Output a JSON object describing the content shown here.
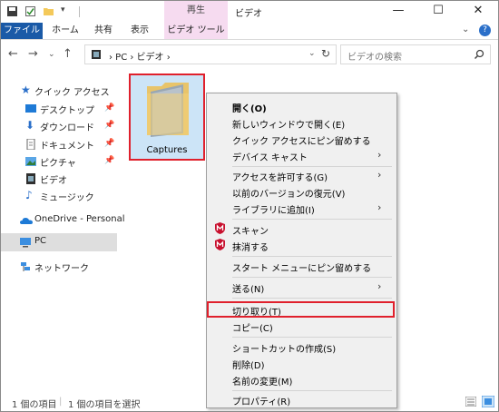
{
  "window": {
    "title": "ビデオ",
    "tools_group_label": "再生",
    "controls": {
      "minimize": "—",
      "maximize": "☐",
      "close": "✕"
    }
  },
  "ribbon": {
    "tabs": {
      "file": "ファイル",
      "home": "ホーム",
      "share": "共有",
      "view": "表示",
      "video_tools": "ビデオ ツール"
    },
    "expand_glyph": "⌄",
    "help_glyph": "?"
  },
  "address": {
    "path": "›  PC  ›  ビデオ  ›",
    "search_placeholder": "ビデオの検索"
  },
  "sidebar": {
    "items": [
      {
        "label": "クイック アクセス",
        "icon": "star-icon"
      },
      {
        "label": "デスクトップ",
        "icon": "desktop-icon",
        "pinned": true
      },
      {
        "label": "ダウンロード",
        "icon": "download-icon",
        "pinned": true
      },
      {
        "label": "ドキュメント",
        "icon": "document-icon",
        "pinned": true
      },
      {
        "label": "ピクチャ",
        "icon": "pictures-icon",
        "pinned": true
      },
      {
        "label": "ビデオ",
        "icon": "video-icon"
      },
      {
        "label": "ミュージック",
        "icon": "music-icon"
      },
      {
        "label": "OneDrive - Personal",
        "icon": "onedrive-icon"
      },
      {
        "label": "PC",
        "icon": "pc-icon",
        "selected": true
      },
      {
        "label": "ネットワーク",
        "icon": "network-icon"
      }
    ]
  },
  "content": {
    "folder": {
      "name": "Captures"
    }
  },
  "context_menu": {
    "open": "開く(O)",
    "open_new_window": "新しいウィンドウで開く(E)",
    "pin_quick_access": "クイック アクセスにピン留めする",
    "cast_device": "デバイス キャスト",
    "give_access": "アクセスを許可する(G)",
    "restore_versions": "以前のバージョンの復元(V)",
    "add_library": "ライブラリに追加(I)",
    "scan": "スキャン",
    "shred": "抹消する",
    "pin_start": "スタート メニューにピン留めする",
    "send_to": "送る(N)",
    "cut": "切り取り(T)",
    "copy": "コピー(C)",
    "create_shortcut": "ショートカットの作成(S)",
    "delete": "削除(D)",
    "rename": "名前の変更(M)",
    "properties": "プロパティ(R)"
  },
  "status": {
    "item_count": "1 個の項目",
    "selected": "1 個の項目を選択"
  },
  "colors": {
    "accent": "#1a5aa7",
    "highlight": "#e0202c",
    "selection": "#cce4f7",
    "mcafee": "#c8102e"
  }
}
